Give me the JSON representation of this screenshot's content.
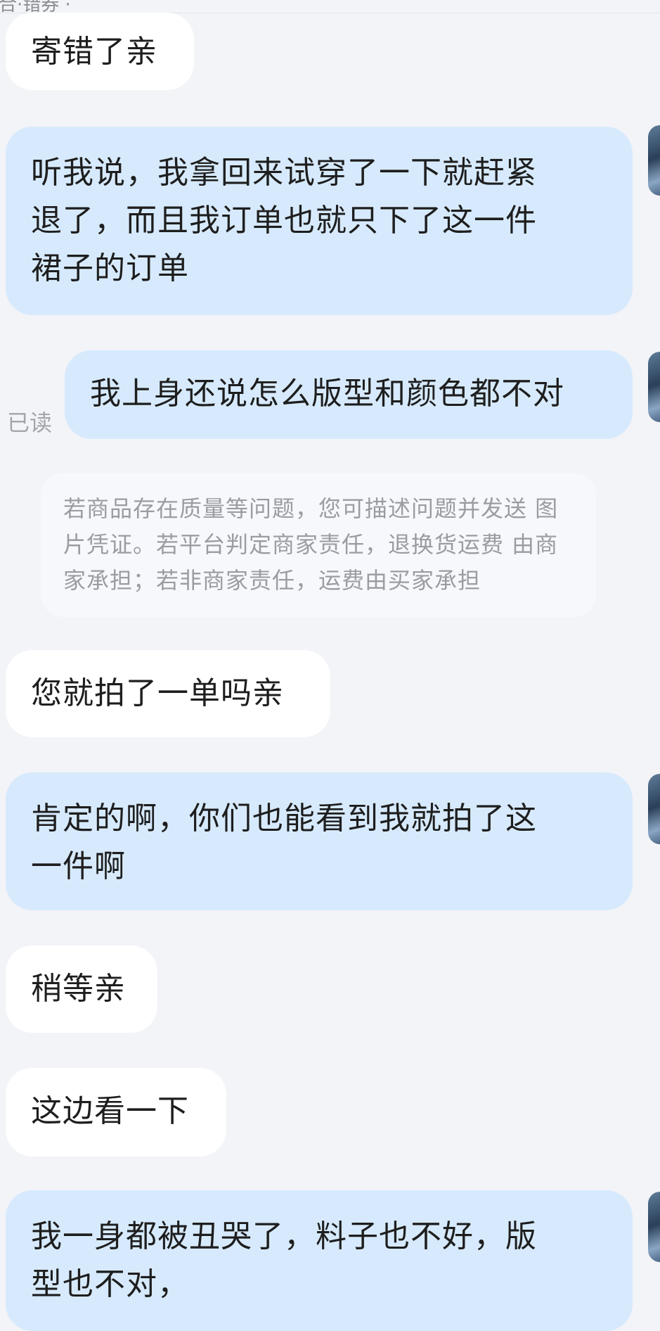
{
  "header": {
    "partial_text": "合·错券 ·"
  },
  "messages": [
    {
      "side": "recv",
      "text": "寄错了亲"
    },
    {
      "side": "sent",
      "text": "听我说，我拿回来试穿了一下就赶紧\n退了，而且我订单也就只下了这一件\n裙子的订单"
    },
    {
      "side": "sent",
      "text": "我上身还说怎么版型和颜色都不对",
      "status": "已读"
    },
    {
      "side": "system",
      "text": "若商品存在质量等问题，您可描述问题并发送\n图片凭证。若平台判定商家责任，退换货运费\n由商家承担；若非商家责任，运费由买家承担"
    },
    {
      "side": "recv",
      "text": "您就拍了一单吗亲"
    },
    {
      "side": "sent",
      "text": "肯定的啊，你们也能看到我就拍了这\n一件啊"
    },
    {
      "side": "recv",
      "text": "稍等亲"
    },
    {
      "side": "recv",
      "text": "这边看一下"
    },
    {
      "side": "sent",
      "text": "我一身都被丑哭了，料子也不好，版\n型也不对，"
    }
  ],
  "colors": {
    "background": "#f3f4f8",
    "received_bubble": "#ffffff",
    "sent_bubble": "#d7eafd",
    "system_text": "#9a9ca2"
  },
  "icons": {
    "avatar": "user-avatar"
  }
}
